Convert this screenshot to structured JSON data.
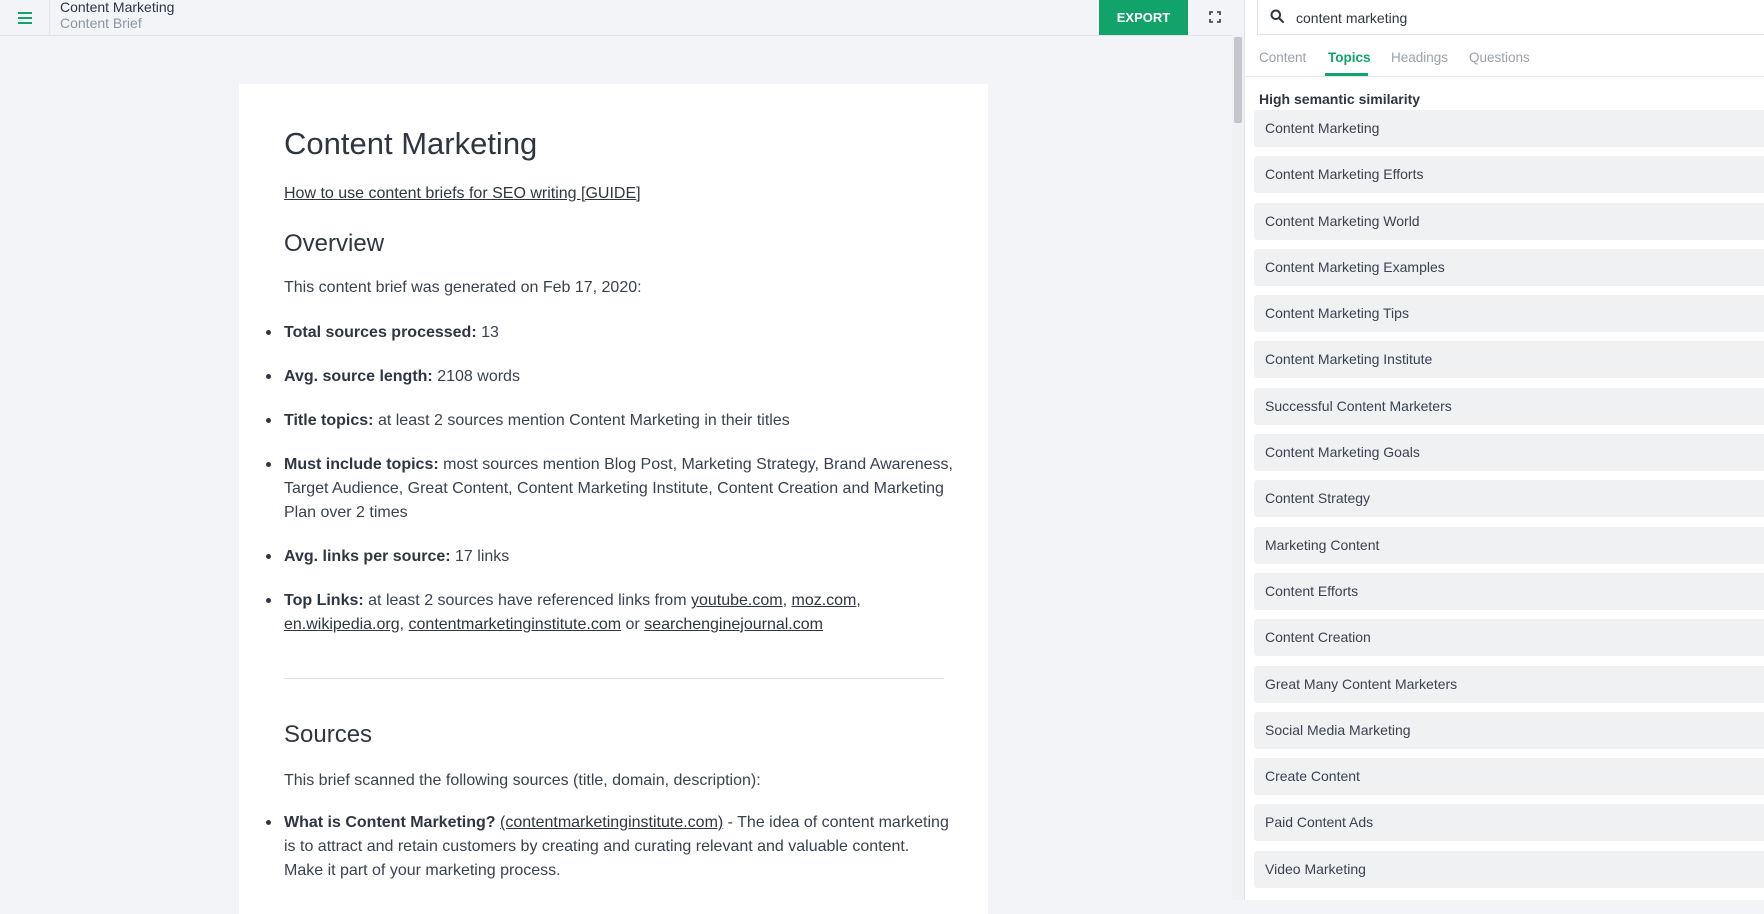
{
  "header": {
    "title": "Content Marketing",
    "subtitle": "Content Brief",
    "export_label": "EXPORT"
  },
  "icons": {
    "menu": "hamburger-menu-icon",
    "fullscreen": "fullscreen-icon",
    "search": "search-icon"
  },
  "colors": {
    "accent": "#11a36a",
    "background": "#f3f4f7",
    "topic_bg": "#f0f1f3"
  },
  "doc": {
    "title": "Content Marketing",
    "guide_link": "How to use content briefs for SEO writing [GUIDE]",
    "overview_heading": "Overview",
    "generated_text": "This content brief was generated on Feb 17, 2020:",
    "stats": {
      "sources_label": "Total sources processed:",
      "sources_value": "13",
      "length_label": "Avg. source length:",
      "length_value": "2108 words",
      "title_topics_label": "Title topics:",
      "title_topics_value": "at least 2 sources mention Content Marketing in their titles",
      "must_label": "Must include topics:",
      "must_line1": "most sources mention Blog Post, Marketing Strategy, Brand Awareness,",
      "must_line2": "Target Audience, Great Content, Content Marketing Institute, Content Creation and Marketing",
      "must_line3": "Plan over 2 times",
      "links_label": "Avg. links per source:",
      "links_value": "17 links",
      "top_links_label": "Top Links:",
      "top_links_text": "at least 2 sources have referenced links from",
      "top_links": [
        "youtube.com",
        "moz.com",
        "en.wikipedia.org",
        "contentmarketinginstitute.com",
        "searchenginejournal.com"
      ],
      "or_text": "or"
    },
    "sources_heading": "Sources",
    "sources_intro": "This brief scanned the following sources (title, domain, description):",
    "source1": {
      "title": "What is Content Marketing?",
      "domain": "(contentmarketinginstitute.com)",
      "desc_line1": "- The idea of content marketing",
      "desc_line2": "is to attract and retain customers by creating and curating relevant and valuable content.",
      "desc_line3": "Make it part of your marketing process."
    }
  },
  "panel": {
    "search_value": "content marketing",
    "tabs": [
      "Content",
      "Topics",
      "Headings",
      "Questions"
    ],
    "active_tab": "Topics",
    "section_title": "High semantic similarity",
    "topics": [
      "Content Marketing",
      "Content Marketing Efforts",
      "Content Marketing World",
      "Content Marketing Examples",
      "Content Marketing Tips",
      "Content Marketing Institute",
      "Successful Content Marketers",
      "Content Marketing Goals",
      "Content Strategy",
      "Marketing Content",
      "Content Efforts",
      "Content Creation",
      "Great Many Content Marketers",
      "Social Media Marketing",
      "Create Content",
      "Paid Content Ads",
      "Video Marketing"
    ]
  }
}
